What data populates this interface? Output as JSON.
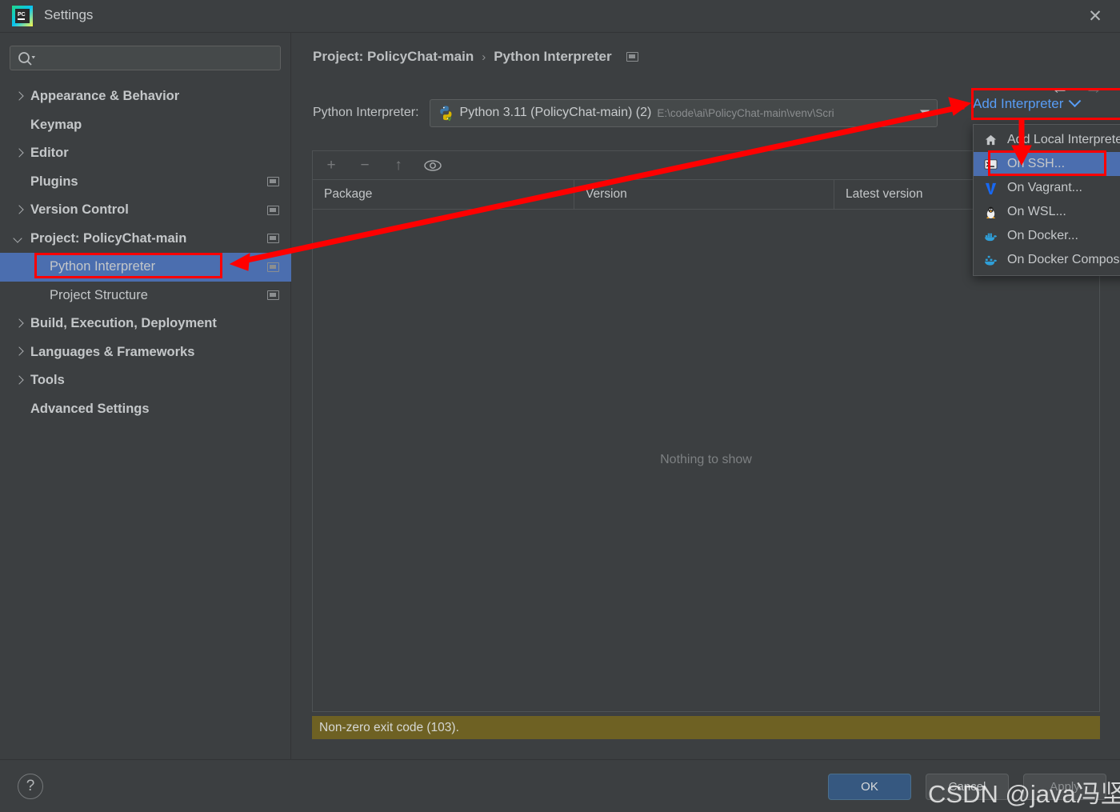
{
  "window": {
    "title": "Settings",
    "app_icon": "pycharm-logo",
    "close_icon": "close-icon"
  },
  "sidebar": {
    "search": {
      "placeholder": "",
      "value": "",
      "icon": "search-icon"
    },
    "items": [
      {
        "label": "Appearance & Behavior",
        "expandable": true,
        "expanded": false,
        "child": false,
        "badge": false,
        "selected": false
      },
      {
        "label": "Keymap",
        "expandable": false,
        "expanded": false,
        "child": false,
        "badge": false,
        "selected": false
      },
      {
        "label": "Editor",
        "expandable": true,
        "expanded": false,
        "child": false,
        "badge": false,
        "selected": false
      },
      {
        "label": "Plugins",
        "expandable": false,
        "expanded": false,
        "child": false,
        "badge": true,
        "selected": false
      },
      {
        "label": "Version Control",
        "expandable": true,
        "expanded": false,
        "child": false,
        "badge": true,
        "selected": false
      },
      {
        "label": "Project: PolicyChat-main",
        "expandable": true,
        "expanded": true,
        "child": false,
        "badge": true,
        "selected": false
      },
      {
        "label": "Python Interpreter",
        "expandable": false,
        "expanded": false,
        "child": true,
        "badge": true,
        "selected": true
      },
      {
        "label": "Project Structure",
        "expandable": false,
        "expanded": false,
        "child": true,
        "badge": true,
        "selected": false
      },
      {
        "label": "Build, Execution, Deployment",
        "expandable": true,
        "expanded": false,
        "child": false,
        "badge": false,
        "selected": false
      },
      {
        "label": "Languages & Frameworks",
        "expandable": true,
        "expanded": false,
        "child": false,
        "badge": false,
        "selected": false
      },
      {
        "label": "Tools",
        "expandable": true,
        "expanded": false,
        "child": false,
        "badge": false,
        "selected": false
      },
      {
        "label": "Advanced Settings",
        "expandable": false,
        "expanded": false,
        "child": false,
        "badge": false,
        "selected": false
      }
    ]
  },
  "main": {
    "breadcrumb": {
      "parent": "Project: PolicyChat-main",
      "separator": "›",
      "current": "Python Interpreter"
    },
    "nav": {
      "back_icon": "arrow-left-icon",
      "forward_icon": "arrow-right-icon"
    },
    "interpreter": {
      "label": "Python Interpreter:",
      "icon": "python-venv-icon",
      "name": "Python 3.11 (PolicyChat-main) (2)",
      "path": "E:\\code\\ai\\PolicyChat-main\\venv\\Scri",
      "dropdown_icon": "chevron-down-icon"
    },
    "add_interpreter": {
      "label": "Add Interpreter",
      "chevron_icon": "chevron-down-icon"
    },
    "packages": {
      "toolbar": [
        {
          "name": "add-package-button",
          "glyph": "+"
        },
        {
          "name": "remove-package-button",
          "glyph": "−"
        },
        {
          "name": "upgrade-package-button",
          "glyph": "↑"
        },
        {
          "name": "show-early-releases-button",
          "glyph": "eye"
        }
      ],
      "columns": [
        "Package",
        "Version",
        "Latest version"
      ],
      "rows": [],
      "empty_text": "Nothing to show"
    },
    "error": {
      "text": "Non-zero exit code (103)."
    }
  },
  "menu": {
    "items": [
      {
        "label": "Add Local Interpreter...",
        "icon": "home-icon",
        "active": false
      },
      {
        "label": "On SSH...",
        "icon": "terminal-icon",
        "active": true
      },
      {
        "label": "On Vagrant...",
        "icon": "vagrant-icon",
        "active": false
      },
      {
        "label": "On WSL...",
        "icon": "linux-penguin-icon",
        "active": false
      },
      {
        "label": "On Docker...",
        "icon": "docker-icon",
        "active": false
      },
      {
        "label": "On Docker Compose...",
        "icon": "docker-compose-icon",
        "active": false
      }
    ]
  },
  "footer": {
    "help_label": "?",
    "ok_label": "OK",
    "cancel_label": "Cancel",
    "apply_label": "Apply"
  },
  "watermark": {
    "text": "CSDN @java冯坚持"
  },
  "colors": {
    "background": "#3c3f41",
    "selection": "#4b6eaf",
    "link": "#589df6",
    "error_bar": "#6e6123",
    "annotation": "#ff0000",
    "ok_button": "#365880"
  }
}
